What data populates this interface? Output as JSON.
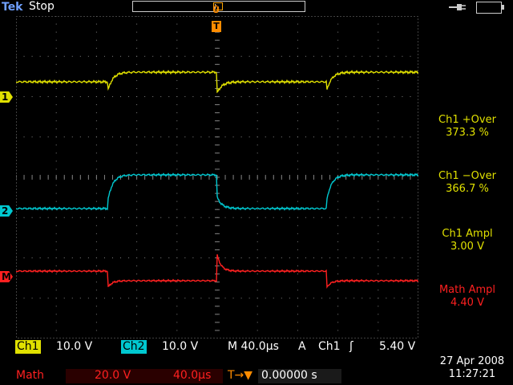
{
  "topbar": {
    "brand": "Tek",
    "run_state": "Stop",
    "trigger_top_glyph": "Ů"
  },
  "icons": {
    "power": "power-plug-icon",
    "battery": "battery-icon"
  },
  "markers": {
    "ch1": "1",
    "ch2": "2",
    "math": "M",
    "trigger": "T"
  },
  "colors": {
    "ch1": "#e0e000",
    "ch2": "#00c8d0",
    "math": "#ff2020",
    "trigger": "#ff8c00",
    "graticule": "#808080"
  },
  "measurements": [
    {
      "label": "Ch1 +Over",
      "value": "373.3 %",
      "color": "yellow"
    },
    {
      "label": "Ch1 −Over",
      "value": "366.7 %",
      "color": "yellow"
    },
    {
      "label": "Ch1 Ampl",
      "value": "3.00 V",
      "color": "yellow"
    },
    {
      "label": "Math Ampl",
      "value": "4.40 V",
      "color": "red"
    }
  ],
  "readouts": {
    "ch1_label": "Ch1",
    "ch1_scale": "10.0 V",
    "ch2_label": "Ch2",
    "ch2_scale": "10.0 V",
    "timebase": "M 40.0µs",
    "trigger_mode": "A",
    "trigger_source": "Ch1",
    "trigger_slope": "ʃ",
    "trigger_level": "5.40 V",
    "math_label": "Math",
    "math_scale": "20.0 V",
    "math_time": "40.0µs",
    "trigger_pos_glyph": "T→▼",
    "trigger_pos": "0.00000 s"
  },
  "datetime": {
    "date": "27 Apr  2008",
    "time": "11:27:21"
  }
}
